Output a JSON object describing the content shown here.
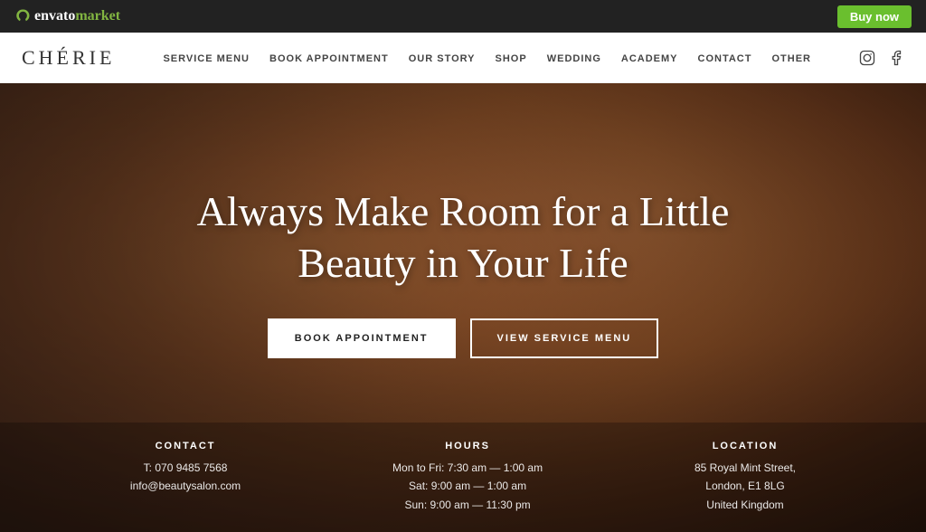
{
  "envato_bar": {
    "logo_white": "envato",
    "logo_green": "market",
    "buy_btn": "Buy now"
  },
  "navbar": {
    "logo": "CHÉRIE",
    "nav_items": [
      {
        "label": "SERVICE MENU",
        "href": "#"
      },
      {
        "label": "BOOK APPOINTMENT",
        "href": "#"
      },
      {
        "label": "OUR STORY",
        "href": "#"
      },
      {
        "label": "SHOP",
        "href": "#"
      },
      {
        "label": "WEDDING",
        "href": "#"
      },
      {
        "label": "ACADEMY",
        "href": "#"
      },
      {
        "label": "CONTACT",
        "href": "#"
      },
      {
        "label": "OTHER",
        "href": "#"
      }
    ]
  },
  "hero": {
    "headline_line1": "Always Make Room for a Little",
    "headline_line2": "Beauty in Your Life",
    "btn_primary": "BOOK APPOINTMENT",
    "btn_secondary": "VIEW SERVICE MENU"
  },
  "footer_info": {
    "contact": {
      "heading": "CONTACT",
      "phone": "T: 070 9485 7568",
      "email": "info@beautysalon.com"
    },
    "hours": {
      "heading": "HOURS",
      "line1": "Mon to Fri: 7:30 am — 1:00 am",
      "line2": "Sat: 9:00 am — 1:00 am",
      "line3": "Sun: 9:00 am — 11:30 pm"
    },
    "location": {
      "heading": "LOCATION",
      "line1": "85 Royal Mint Street,",
      "line2": "London, E1 8LG",
      "line3": "United Kingdom"
    }
  }
}
